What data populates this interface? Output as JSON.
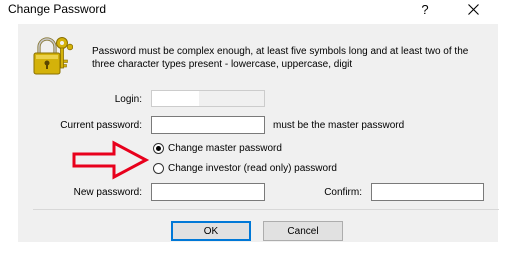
{
  "window": {
    "title": "Change Password",
    "help_label": "?",
    "close_label": "Close"
  },
  "info_text": "Password must be complex enough, at least five symbols long and at least two of the three character types present - lowercase, uppercase, digit",
  "login": {
    "label": "Login:",
    "value": ""
  },
  "current_password": {
    "label": "Current password:",
    "value": "",
    "hint": "must be the master password"
  },
  "options": {
    "master": {
      "label": "Change master password",
      "checked": true
    },
    "investor": {
      "label": "Change investor (read only) password",
      "checked": false
    }
  },
  "new_password": {
    "label": "New password:",
    "value": ""
  },
  "confirm": {
    "label": "Confirm:",
    "value": ""
  },
  "buttons": {
    "ok": "OK",
    "cancel": "Cancel"
  },
  "colors": {
    "panel": "#f0f0f0",
    "arrow": "#e8001c",
    "lock_gold": "#d4b20a",
    "default_button_border": "#0078d7"
  },
  "icons": {
    "lock": "padlock-with-keys-icon",
    "arrow": "red-outline-arrow-icon",
    "close": "close-icon"
  }
}
